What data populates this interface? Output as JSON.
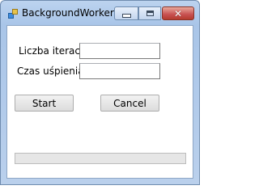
{
  "window": {
    "title": "BackgroundWorker",
    "controls": {
      "minimize_icon": "minimize-icon",
      "maximize_icon": "maximize-icon",
      "close_icon": "close-icon",
      "close_glyph": "✕"
    }
  },
  "form": {
    "iterations_label": "Liczba iteracji",
    "iterations_value": "",
    "sleep_label": "Czas uśpienia",
    "sleep_value": "",
    "start_label": "Start",
    "cancel_label": "Cancel",
    "progress_fraction": 0
  },
  "colors": {
    "titlebar": "#bcd3ef",
    "close_button": "#c75050",
    "progress_fill": "#06b025"
  }
}
